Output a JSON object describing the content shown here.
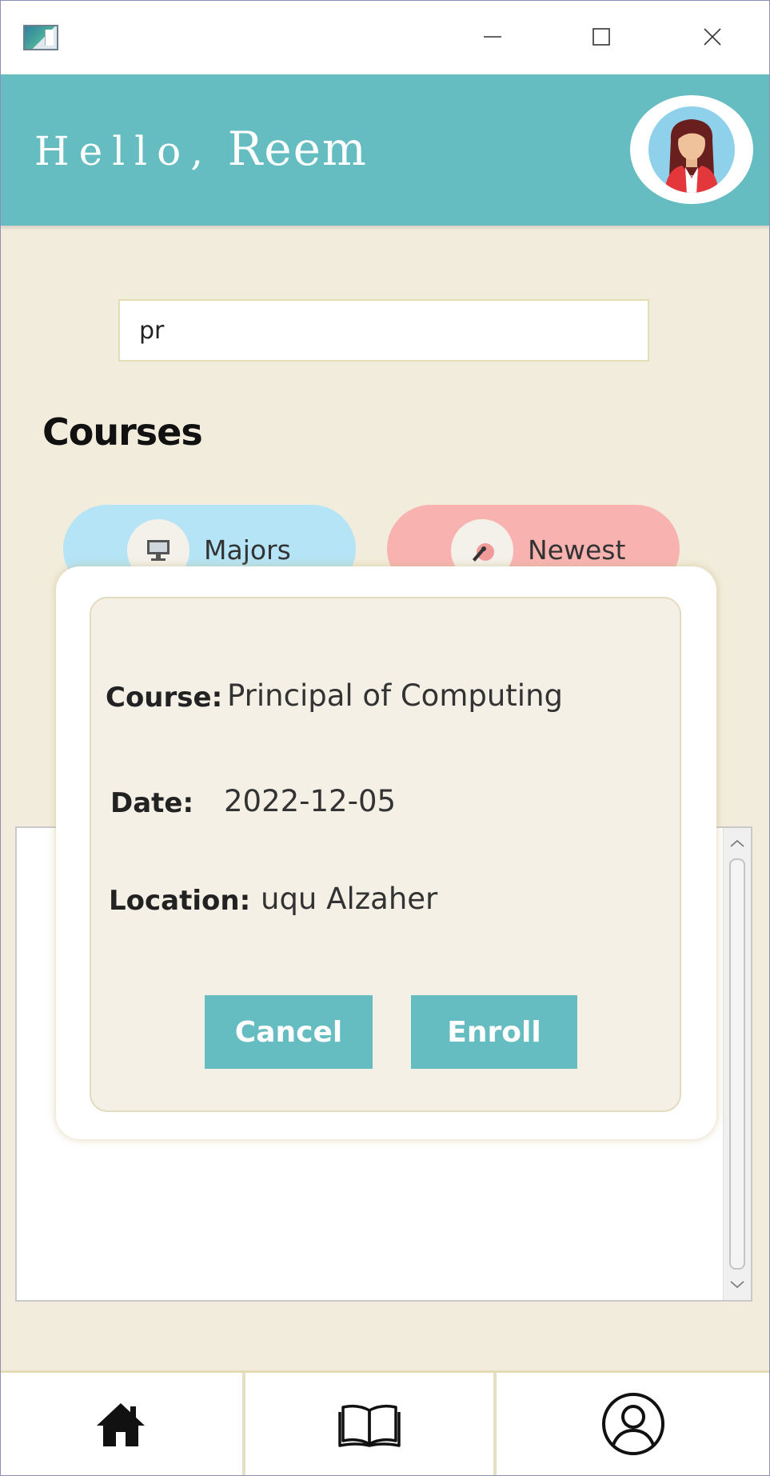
{
  "window": {
    "controls": [
      "minimize",
      "maximize",
      "close"
    ]
  },
  "header": {
    "greeting": "Hello,",
    "user_name": "Reem",
    "avatar_icon": "user-avatar-icon",
    "accent_color": "#66bdc1"
  },
  "search": {
    "value": "pr"
  },
  "courses": {
    "title": "Courses",
    "categories": [
      {
        "label": "Majors",
        "icon": "computer-icon",
        "color": "#b4e4f6"
      },
      {
        "label": "Newest",
        "icon": "megaphone-icon",
        "color": "#f8b3b1"
      }
    ]
  },
  "dialog": {
    "course_label": "Course:",
    "course_value": "Principal of Computing",
    "date_label": "Date:",
    "date_value": "2022-12-05",
    "location_label": "Location:",
    "location_value": "uqu Alzaher",
    "cancel_label": "Cancel",
    "enroll_label": "Enroll"
  },
  "bottom_nav": {
    "items": [
      {
        "name": "home",
        "icon": "home-icon"
      },
      {
        "name": "courses",
        "icon": "book-icon"
      },
      {
        "name": "profile",
        "icon": "profile-icon"
      }
    ]
  }
}
